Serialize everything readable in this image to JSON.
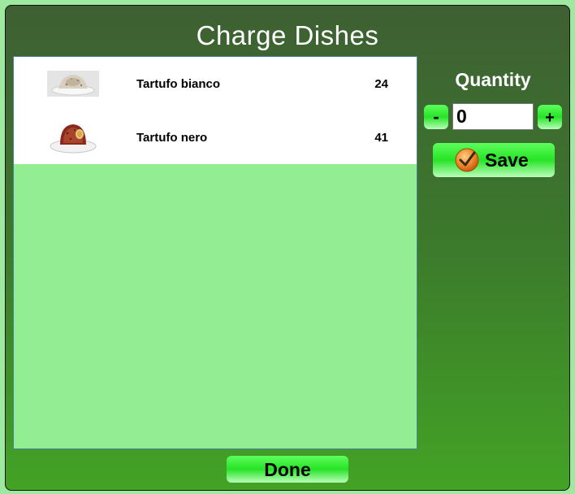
{
  "dialog": {
    "title": "Charge Dishes"
  },
  "dishes": [
    {
      "name": "Tartufo bianco",
      "quantity": "24",
      "image": "tartufo-bianco-image"
    },
    {
      "name": "Tartufo nero",
      "quantity": "41",
      "image": "tartufo-nero-image"
    }
  ],
  "quantity_panel": {
    "label": "Quantity",
    "minus_label": "-",
    "plus_label": "+",
    "value": "0"
  },
  "save_button": {
    "label": "Save",
    "icon": "check-icon"
  },
  "done_button": {
    "label": "Done"
  },
  "colors": {
    "header_green": "#3e5f33",
    "list_background": "#93ee93",
    "button_green": "#27e327"
  }
}
